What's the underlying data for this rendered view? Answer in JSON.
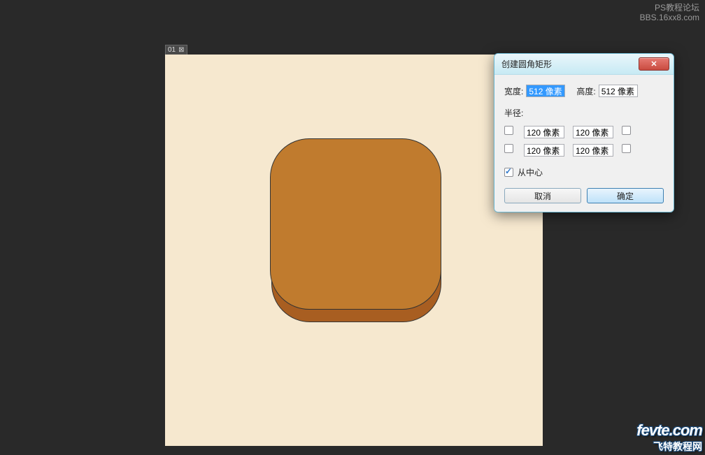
{
  "watermark_top": {
    "line1": "PS教程论坛",
    "line2": "BBS.16xx8.com"
  },
  "watermark_bottom": {
    "logo": "fevte.com",
    "subtitle": "飞特教程网"
  },
  "canvas_tab": {
    "label": "01"
  },
  "dialog": {
    "title": "创建圆角矩形",
    "width_label": "宽度:",
    "width_value": "512 像素",
    "height_label": "高度:",
    "height_value": "512 像素",
    "radius_label": "半径:",
    "radius": {
      "tl": "120 像素",
      "tr": "120 像素",
      "bl": "120 像素",
      "br": "120 像素"
    },
    "from_center_label": "从中心",
    "from_center_checked": true,
    "cancel": "取消",
    "ok": "确定"
  }
}
